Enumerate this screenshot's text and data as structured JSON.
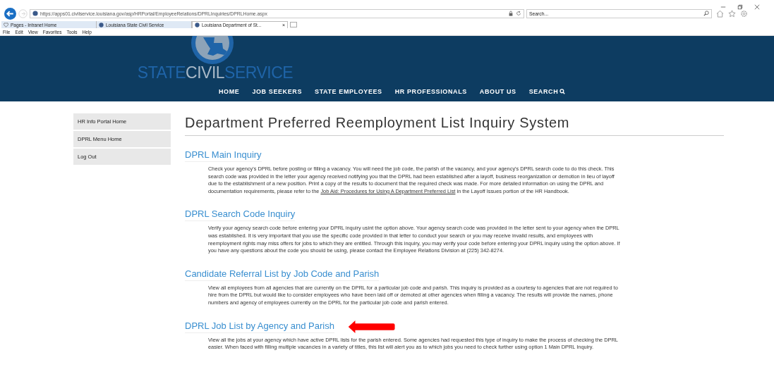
{
  "browser": {
    "url": "https://apps01.civilservice.louisiana.gov/asp/HRPortal/EmployeeRelations/DPRLInquiries/DPRLHome.aspx",
    "search_placeholder": "Search...",
    "tabs": [
      {
        "label": "Pages - Intranet Home",
        "selected": false
      },
      {
        "label": "Louisiana State Civil Service",
        "selected": false
      },
      {
        "label": "Louisiana Department of St...",
        "selected": true,
        "close": "×"
      }
    ],
    "menu": [
      "File",
      "Edit",
      "View",
      "Favorites",
      "Tools",
      "Help"
    ]
  },
  "banner": {
    "logo_parts": [
      {
        "text": "STATE",
        "kind": "dim"
      },
      {
        "text": "CIVIL",
        "kind": "light"
      },
      {
        "text": "SERVICE",
        "kind": "dim"
      }
    ],
    "nav": [
      {
        "label": "HOME"
      },
      {
        "label": "JOB SEEKERS"
      },
      {
        "label": "STATE EMPLOYEES"
      },
      {
        "label": "HR PROFESSIONALS"
      },
      {
        "label": "ABOUT US"
      },
      {
        "label": "SEARCH",
        "kind": "search"
      }
    ]
  },
  "sidebar": {
    "items": [
      "HR Info Portal Home",
      "DPRL Menu Home",
      "Log Out"
    ]
  },
  "page_title": "Department Preferred Reemployment List Inquiry System",
  "sections": [
    {
      "title": "DPRL Main Inquiry",
      "kind": "plain",
      "text": "Check your agency's DPRL before posting or filling a vacancy.  You will need the job code, the parish of the vacancy, and your agency's DPRL search code to do this check.  This search code was provided in the letter your agency received notifying you that the DPRL had been established after a layoff, business reorganization or demotion in lieu of layoff due to the establishment of a new position.  Print a copy of the results to document that the required check was made.  For more detailed information on using the DPRL and documentation requirements, please refer to the ",
      "link": "Job Aid: Procedures for Using A Department Preferred List",
      "text_after": " in the Layoff Issues portion of the HR Handbook."
    },
    {
      "title": "DPRL Search Code Inquiry",
      "kind": "plain",
      "text": "Verify your agency search code before entering your DPRL inquiry usint the option above. Your agency search code was provided in the letter sent to your agency when the DPRL was established.  It is very important that you use the specific code provided in that letter to conduct your search or you may receive invalid results, and employees with reemployment rights may miss offers for jobs to which they are entitled.  Through this inquiry, you may verify your code before entering your DPRL inquiry using the option above.  If you have any questions about the code you should be using, please contact the Employee Relations Division at (225) 342-8274."
    },
    {
      "title": "Candidate Referral List by Job Code and Parish",
      "kind": "plain",
      "text": "View all employees from all agencies that are currently on the DPRL for a particular job code and parish.  This inquiry is provided as a courtesy to agencies that are not required to hire from the DPRL but would like to consider employees who have been laid off or demoted at other agencies when filling a vacancy.  The results will provide the names, phone numbers and agency of employees currently on the DPRL for the particular job code and parish entered."
    },
    {
      "title": "DPRL Job List by Agency and Parish",
      "kind": "arrowed",
      "text": "View all the jobs at your agency which have active DPRL lists for the parish entered.  Some agencies had requested this type of inquiry to make the process of checking the DPRL easier.  When faced with filling multiple vacancies in a variety of titles, this list will alert you as to which jobs you need to check further using option 1 Main DPRL Inquiry."
    }
  ]
}
